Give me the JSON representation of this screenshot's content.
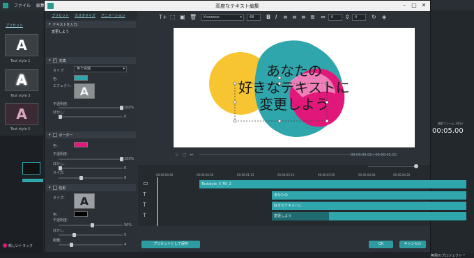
{
  "background": {
    "menu": [
      "ファイル",
      "編集"
    ],
    "sidebar_tab": "プリセット",
    "thumbs": [
      "Text style 1",
      "Text style 3",
      "Text style 5"
    ],
    "right_time": "00:05.00",
    "right_label": "撮影フレーム 30fps",
    "bottom_left": "新しいトラック",
    "bottom_right": "無題のプロジェクト *"
  },
  "dialog": {
    "title": "高度なテキスト編集",
    "tabs": [
      "プリセット",
      "カスタマイズ",
      "アニメーション"
    ],
    "text_input_label": "テキストを入力:",
    "text_input_value": "変更しよう",
    "fill": {
      "label": "充填",
      "type_label": "タイプ:",
      "type_value": "色で充填",
      "color_label": "色:",
      "effect_label": "エフェクト:",
      "opacity_label": "不透明度:",
      "opacity_value": "100%",
      "blur_label": "ぼかし:",
      "blur_value": "0"
    },
    "border": {
      "label": "ボーダー",
      "color_label": "色:",
      "opacity_label": "不透明度:",
      "opacity_value": "100%",
      "blur_label": "ぼかし:",
      "blur_value": "0",
      "size_label": "サイズ:",
      "size_value": "8"
    },
    "shadow": {
      "label": "陰影",
      "type_label": "タイプ:",
      "color_label": "色:",
      "opacity_label": "不透明度:",
      "opacity_value": "50%",
      "blur_label": "ぼかし:",
      "blur_value": "5",
      "distance_label": "距離:",
      "distance_value": "4"
    },
    "toolbar": {
      "font": "Knewave",
      "size": "68",
      "spacing": "0",
      "line": "0"
    },
    "preview_lines": [
      "あなたの",
      "好きなテキストに",
      "変更しよう"
    ],
    "playback_time": "00:00:00:00 / 00:00:05:00",
    "ruler": [
      "00:00:00:00",
      "00:00:00:20",
      "00:00:01:15",
      "00:00:02:10",
      "00:00:03:05",
      "00:00:04:00",
      "00:00:04:20"
    ],
    "tracks": [
      "Textstyle_3_Fill_2",
      "あなたの",
      "好きなテキストに",
      "変更しよう"
    ],
    "save_preset": "プリセットとして保存",
    "ok": "OK",
    "cancel": "キャンセル"
  },
  "colors": {
    "teal": "#2fa5ac",
    "yellow": "#f7c531",
    "magenta": "#e2177a",
    "lightpink": "#ef8bbf"
  }
}
